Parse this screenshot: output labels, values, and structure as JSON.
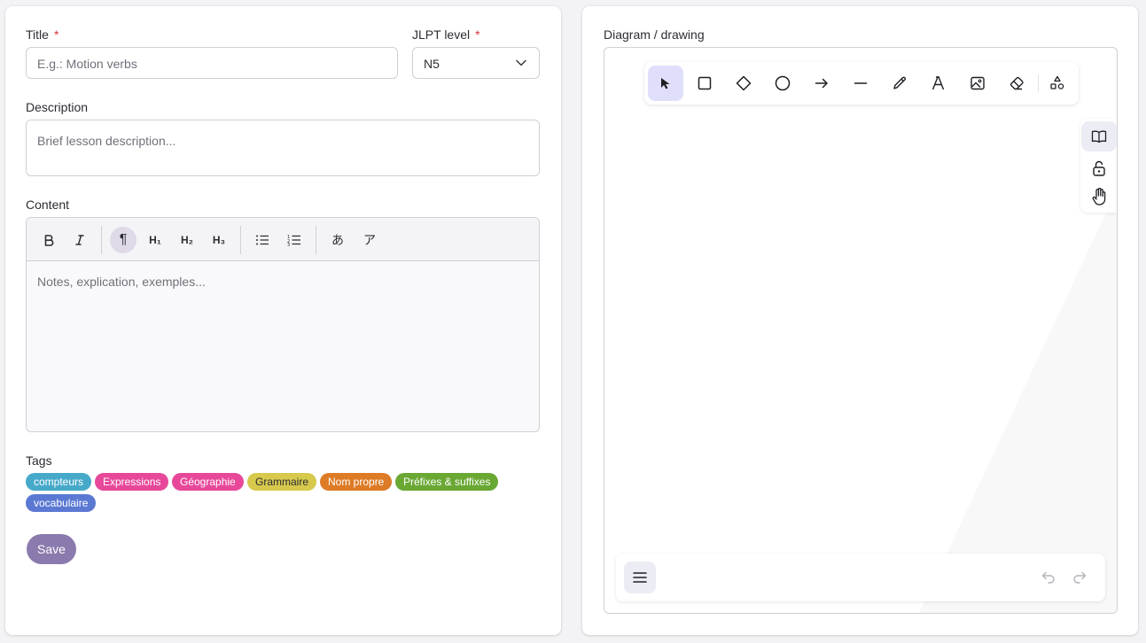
{
  "form": {
    "title_label": "Title",
    "required_mark": "*",
    "title_placeholder": "E.g.: Motion verbs",
    "jlpt_label": "JLPT level",
    "jlpt_value": "N5",
    "description_label": "Description",
    "description_placeholder": "Brief lesson description...",
    "content_label": "Content",
    "content_placeholder": "Notes, explication, exemples...",
    "tags_label": "Tags",
    "save_label": "Save"
  },
  "editor_toolbar": {
    "bold": "B",
    "italic": "I",
    "paragraph": "¶",
    "h1": "H₁",
    "h2": "H₂",
    "h3": "H₃",
    "hiragana": "あ",
    "katakana": "ア"
  },
  "tags": [
    {
      "label": "compteurs",
      "color": "#47a9c9"
    },
    {
      "label": "Expressions",
      "color": "#e8489a"
    },
    {
      "label": "Géographie",
      "color": "#e8489a"
    },
    {
      "label": "Grammaire",
      "color": "#d6c94c",
      "text_color": "#2c2c33"
    },
    {
      "label": "Nom propre",
      "color": "#dd7b27"
    },
    {
      "label": "Préfixes & suffixes",
      "color": "#6aa834"
    },
    {
      "label": "vocabulaire",
      "color": "#5b78d3"
    }
  ],
  "diagram": {
    "label": "Diagram / drawing",
    "tools": [
      "selection-icon",
      "rectangle-icon",
      "diamond-icon",
      "ellipse-icon",
      "arrow-icon",
      "line-icon",
      "draw-icon",
      "text-icon",
      "image-icon",
      "eraser-icon",
      "more-shapes-icon"
    ],
    "side_tools": [
      "library-icon",
      "unlock-icon",
      "hand-icon"
    ]
  },
  "colors": {
    "accent": "#8b7aad",
    "active_tool_bg": "#e0dffb"
  }
}
